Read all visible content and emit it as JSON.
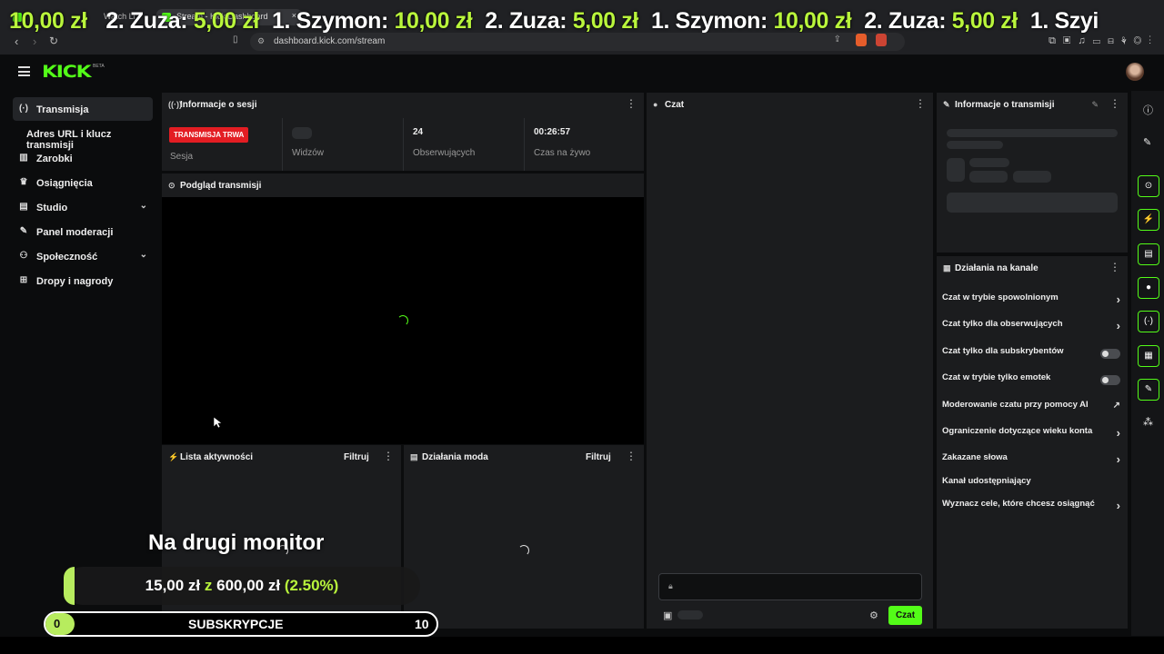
{
  "browser": {
    "tabs": [
      {
        "label": "Watch Li"
      },
      {
        "label": "Stream - Kick Dashboard"
      }
    ],
    "url": "dashboard.kick.com/stream"
  },
  "ticker": {
    "items": [
      {
        "rank": "2. Zuza:",
        "amount": "5,00 zł"
      },
      {
        "rank": "1. Szymon:",
        "amount": "10,00 zł"
      },
      {
        "rank": "2. Zuza:",
        "amount": "5,00 zł"
      },
      {
        "rank": "1. Szymon:",
        "amount": "10,00 zł"
      },
      {
        "rank": "2. Zuza:",
        "amount": "5,00 zł"
      },
      {
        "rank": "1. Szyi",
        "amount": ""
      }
    ],
    "lead_amount": "10,00 zł"
  },
  "app": {
    "logo": "KICK",
    "beta": "BETA"
  },
  "sidebar": {
    "items": [
      {
        "label": "Transmisja",
        "icon": "broadcast-icon"
      },
      {
        "label": "Adres URL i klucz transmisji"
      },
      {
        "label": "Zarobki",
        "icon": "earnings-icon"
      },
      {
        "label": "Osiągnięcia",
        "icon": "trophy-icon"
      },
      {
        "label": "Studio",
        "icon": "studio-icon"
      },
      {
        "label": "Panel moderacji",
        "icon": "wrench-icon"
      },
      {
        "label": "Społeczność",
        "icon": "community-icon"
      },
      {
        "label": "Dropy i nagrody",
        "icon": "gift-icon"
      }
    ]
  },
  "session": {
    "title": "Informacje o sesji",
    "live_badge": "TRANSMISJA TRWA",
    "stats": [
      {
        "label": "Sesja",
        "value": ""
      },
      {
        "label": "Widzów",
        "value": ""
      },
      {
        "label": "Obserwujących",
        "value": "24"
      },
      {
        "label": "Czas na żywo",
        "value": "00:26:57"
      }
    ]
  },
  "preview": {
    "title": "Podgląd transmisji"
  },
  "activity": {
    "title": "Lista aktywności",
    "filter": "Filtruj"
  },
  "modactions": {
    "title": "Działania moda",
    "filter": "Filtruj"
  },
  "chat": {
    "title": "Czat",
    "send_label": "Czat"
  },
  "stream_info": {
    "title": "Informacje o transmisji"
  },
  "channel_actions": {
    "title": "Działania na kanale",
    "items": [
      {
        "label": "Czat w trybie spowolnionym",
        "control": "arrow"
      },
      {
        "label": "Czat tylko dla obserwujących",
        "control": "arrow"
      },
      {
        "label": "Czat tylko dla subskrybentów",
        "control": "toggle",
        "on": false
      },
      {
        "label": "Czat w trybie tylko emotek",
        "control": "toggle",
        "on": false
      },
      {
        "label": "Moderowanie czatu przy pomocy AI",
        "control": "external"
      },
      {
        "label": "Ograniczenie dotyczące wieku konta",
        "control": "arrow"
      },
      {
        "label": "Zakazane słowa",
        "control": "arrow"
      },
      {
        "label": "Kanał udostępniający",
        "control": "none"
      },
      {
        "label": "Wyznacz cele, które chcesz osiągnąć",
        "control": "arrow"
      }
    ]
  },
  "overlay": {
    "title": "Na drugi monitor",
    "goal_current": "15,00 zł",
    "goal_sep": "z",
    "goal_target": "600,00 zł",
    "goal_percent": "(2.50%)",
    "goal_progress": 0.025,
    "subs_current": "0",
    "subs_label": "SUBSKRYPCJE",
    "subs_target": "10"
  },
  "colors": {
    "accent": "#53fc18",
    "live": "#e31d23",
    "goal": "#b9f53c"
  }
}
